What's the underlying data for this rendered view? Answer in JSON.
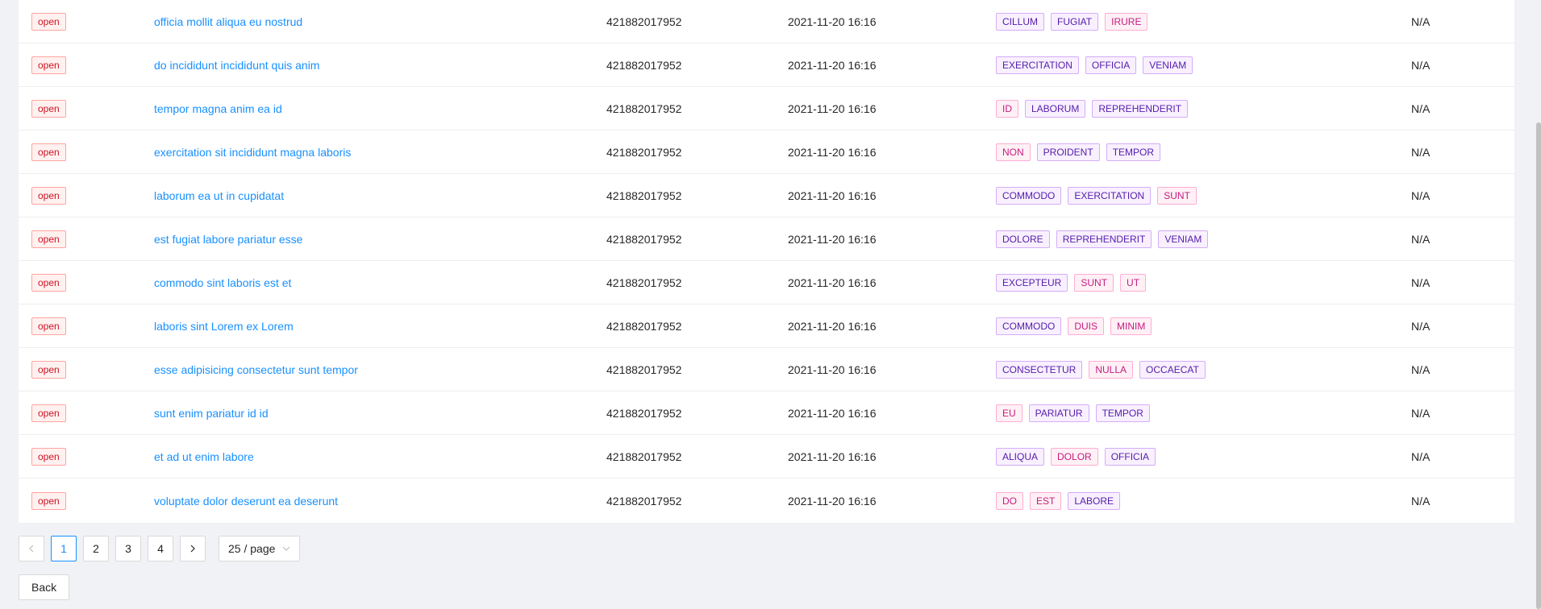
{
  "table": {
    "rows": [
      {
        "status": "open",
        "title": "officia mollit aliqua eu nostrud",
        "number": "421882017952",
        "date": "2021-11-20 16:16",
        "tags": [
          {
            "label": "CILLUM",
            "color": "purple"
          },
          {
            "label": "FUGIAT",
            "color": "purple"
          },
          {
            "label": "IRURE",
            "color": "magenta"
          }
        ],
        "value": "N/A"
      },
      {
        "status": "open",
        "title": "do incididunt incididunt quis anim",
        "number": "421882017952",
        "date": "2021-11-20 16:16",
        "tags": [
          {
            "label": "EXERCITATION",
            "color": "purple"
          },
          {
            "label": "OFFICIA",
            "color": "purple"
          },
          {
            "label": "VENIAM",
            "color": "purple"
          }
        ],
        "value": "N/A"
      },
      {
        "status": "open",
        "title": "tempor magna anim ea id",
        "number": "421882017952",
        "date": "2021-11-20 16:16",
        "tags": [
          {
            "label": "ID",
            "color": "magenta"
          },
          {
            "label": "LABORUM",
            "color": "purple"
          },
          {
            "label": "REPREHENDERIT",
            "color": "purple"
          }
        ],
        "value": "N/A"
      },
      {
        "status": "open",
        "title": "exercitation sit incididunt magna laboris",
        "number": "421882017952",
        "date": "2021-11-20 16:16",
        "tags": [
          {
            "label": "NON",
            "color": "magenta"
          },
          {
            "label": "PROIDENT",
            "color": "purple"
          },
          {
            "label": "TEMPOR",
            "color": "purple"
          }
        ],
        "value": "N/A"
      },
      {
        "status": "open",
        "title": "laborum ea ut in cupidatat",
        "number": "421882017952",
        "date": "2021-11-20 16:16",
        "tags": [
          {
            "label": "COMMODO",
            "color": "purple"
          },
          {
            "label": "EXERCITATION",
            "color": "purple"
          },
          {
            "label": "SUNT",
            "color": "magenta"
          }
        ],
        "value": "N/A"
      },
      {
        "status": "open",
        "title": "est fugiat labore pariatur esse",
        "number": "421882017952",
        "date": "2021-11-20 16:16",
        "tags": [
          {
            "label": "DOLORE",
            "color": "purple"
          },
          {
            "label": "REPREHENDERIT",
            "color": "purple"
          },
          {
            "label": "VENIAM",
            "color": "purple"
          }
        ],
        "value": "N/A"
      },
      {
        "status": "open",
        "title": "commodo sint laboris est et",
        "number": "421882017952",
        "date": "2021-11-20 16:16",
        "tags": [
          {
            "label": "EXCEPTEUR",
            "color": "purple"
          },
          {
            "label": "SUNT",
            "color": "magenta"
          },
          {
            "label": "UT",
            "color": "magenta"
          }
        ],
        "value": "N/A"
      },
      {
        "status": "open",
        "title": "laboris sint Lorem ex Lorem",
        "number": "421882017952",
        "date": "2021-11-20 16:16",
        "tags": [
          {
            "label": "COMMODO",
            "color": "purple"
          },
          {
            "label": "DUIS",
            "color": "magenta"
          },
          {
            "label": "MINIM",
            "color": "magenta"
          }
        ],
        "value": "N/A"
      },
      {
        "status": "open",
        "title": "esse adipisicing consectetur sunt tempor",
        "number": "421882017952",
        "date": "2021-11-20 16:16",
        "tags": [
          {
            "label": "CONSECTETUR",
            "color": "purple"
          },
          {
            "label": "NULLA",
            "color": "magenta"
          },
          {
            "label": "OCCAECAT",
            "color": "purple"
          }
        ],
        "value": "N/A"
      },
      {
        "status": "open",
        "title": "sunt enim pariatur id id",
        "number": "421882017952",
        "date": "2021-11-20 16:16",
        "tags": [
          {
            "label": "EU",
            "color": "magenta"
          },
          {
            "label": "PARIATUR",
            "color": "purple"
          },
          {
            "label": "TEMPOR",
            "color": "purple"
          }
        ],
        "value": "N/A"
      },
      {
        "status": "open",
        "title": "et ad ut enim labore",
        "number": "421882017952",
        "date": "2021-11-20 16:16",
        "tags": [
          {
            "label": "ALIQUA",
            "color": "purple"
          },
          {
            "label": "DOLOR",
            "color": "magenta"
          },
          {
            "label": "OFFICIA",
            "color": "purple"
          }
        ],
        "value": "N/A"
      },
      {
        "status": "open",
        "title": "voluptate dolor deserunt ea deserunt",
        "number": "421882017952",
        "date": "2021-11-20 16:16",
        "tags": [
          {
            "label": "DO",
            "color": "magenta"
          },
          {
            "label": "EST",
            "color": "magenta"
          },
          {
            "label": "LABORE",
            "color": "purple"
          }
        ],
        "value": "N/A"
      }
    ]
  },
  "pagination": {
    "prev_icon": "chevron-left-icon",
    "next_icon": "chevron-right-icon",
    "pages": [
      "1",
      "2",
      "3",
      "4"
    ],
    "current": "1",
    "page_size": "25 / page",
    "page_size_icon": "chevron-down-icon"
  },
  "back_label": "Back",
  "colors": {
    "link": "#1890ff",
    "status_red": "#cf1322",
    "tag_purple": "#531dab",
    "tag_magenta": "#c41d7f",
    "background": "#f0f2f5"
  }
}
